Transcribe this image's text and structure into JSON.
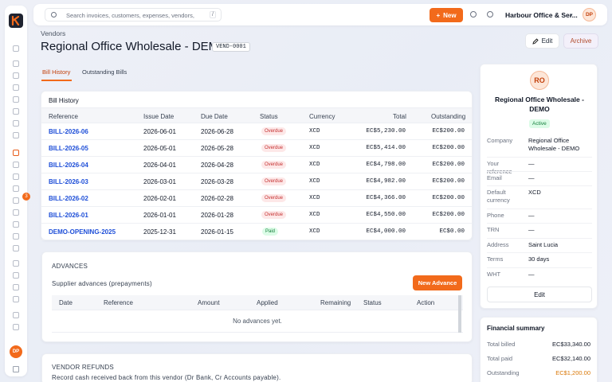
{
  "sidebar": {
    "logo": "K",
    "badge_count": "3",
    "avatar": "DP"
  },
  "topbar": {
    "search_placeholder": "Search invoices, customers, expenses, vendors,",
    "shortcut": "/",
    "new_label": "New",
    "org_name": "Harbour Office & Ser...",
    "avatar": "DP"
  },
  "page": {
    "breadcrumb": "Vendors",
    "title": "Regional Office Wholesale - DEMO",
    "code": "VEND-0001",
    "edit_label": "Edit",
    "archive_label": "Archive",
    "tabs": [
      "Bill History",
      "Outstanding Bills"
    ]
  },
  "bills": {
    "title": "Bill History",
    "headers": [
      "Reference",
      "Issue Date",
      "Due Date",
      "Status",
      "Currency",
      "Total",
      "Outstanding"
    ],
    "rows": [
      {
        "ref": "BILL-2026-06",
        "issue": "2026-06-01",
        "due": "2026-06-28",
        "status": "Overdue",
        "currency": "XCD",
        "total": "EC$5,230.00",
        "outstanding": "EC$200.00"
      },
      {
        "ref": "BILL-2026-05",
        "issue": "2026-05-01",
        "due": "2026-05-28",
        "status": "Overdue",
        "currency": "XCD",
        "total": "EC$5,414.00",
        "outstanding": "EC$200.00"
      },
      {
        "ref": "BILL-2026-04",
        "issue": "2026-04-01",
        "due": "2026-04-28",
        "status": "Overdue",
        "currency": "XCD",
        "total": "EC$4,798.00",
        "outstanding": "EC$200.00"
      },
      {
        "ref": "BILL-2026-03",
        "issue": "2026-03-01",
        "due": "2026-03-28",
        "status": "Overdue",
        "currency": "XCD",
        "total": "EC$4,982.00",
        "outstanding": "EC$200.00"
      },
      {
        "ref": "BILL-2026-02",
        "issue": "2026-02-01",
        "due": "2026-02-28",
        "status": "Overdue",
        "currency": "XCD",
        "total": "EC$4,366.00",
        "outstanding": "EC$200.00"
      },
      {
        "ref": "BILL-2026-01",
        "issue": "2026-01-01",
        "due": "2026-01-28",
        "status": "Overdue",
        "currency": "XCD",
        "total": "EC$4,550.00",
        "outstanding": "EC$200.00"
      },
      {
        "ref": "DEMO-OPENING-2025",
        "issue": "2025-12-31",
        "due": "2026-01-15",
        "status": "Paid",
        "currency": "XCD",
        "total": "EC$4,000.00",
        "outstanding": "EC$0.00"
      }
    ]
  },
  "advances": {
    "section_title": "ADVANCES",
    "subtitle": "Supplier advances (prepayments)",
    "new_label": "New Advance",
    "headers": [
      "Date",
      "Reference",
      "Amount",
      "Applied",
      "Remaining",
      "Status",
      "Action"
    ],
    "empty": "No advances yet."
  },
  "refunds": {
    "section_title": "VENDOR REFUNDS",
    "subtitle": "Record cash received back from this vendor (Dr Bank, Cr Accounts payable)."
  },
  "profile": {
    "initials": "RO",
    "name": "Regional Office Wholesale - DEMO",
    "status": "Active",
    "fields": [
      {
        "k": "Company",
        "v": "Regional Office Wholesale - DEMO"
      },
      {
        "k": "Your reference",
        "v": "—"
      },
      {
        "k": "Email",
        "v": "—"
      },
      {
        "k": "Default currency",
        "v": "XCD"
      },
      {
        "k": "Phone",
        "v": "—"
      },
      {
        "k": "TRN",
        "v": "—"
      },
      {
        "k": "Address",
        "v": "Saint Lucia"
      },
      {
        "k": "Terms",
        "v": "30 days"
      },
      {
        "k": "WHT",
        "v": "—"
      }
    ],
    "edit_label": "Edit"
  },
  "financial": {
    "title": "Financial summary",
    "rows": [
      {
        "k": "Total billed",
        "v": "EC$33,340.00"
      },
      {
        "k": "Total paid",
        "v": "EC$32,140.00"
      },
      {
        "k": "Outstanding",
        "v": "EC$1,200.00"
      }
    ]
  },
  "colors": {
    "accent": "#f26a1b",
    "link": "#1d4ed8",
    "overdue": "#c53030",
    "paid": "#15803d"
  }
}
